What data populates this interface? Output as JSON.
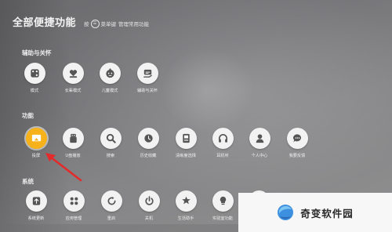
{
  "header": {
    "title": "全部便捷功能",
    "hint_prefix": "按",
    "menu_key_glyph": "☰",
    "hint_middle": "菜单键",
    "hint_suffix": "管理常用功能"
  },
  "sections": {
    "accessibility": {
      "label": "辅助与关怀",
      "items": [
        {
          "label": "模式",
          "icon": "dice-icon"
        },
        {
          "label": "长辈模式",
          "icon": "heart-hand-icon"
        },
        {
          "label": "儿童模式",
          "icon": "child-face-icon"
        },
        {
          "label": "辅助与关怀",
          "icon": "hand-care-icon"
        }
      ]
    },
    "functions": {
      "label": "功能",
      "items": [
        {
          "label": "投屏",
          "icon": "screen-cast-icon",
          "active": true
        },
        {
          "label": "U盘播放",
          "icon": "usb-drive-icon"
        },
        {
          "label": "搜索",
          "icon": "search-icon"
        },
        {
          "label": "历史收藏",
          "icon": "history-clock-icon"
        },
        {
          "label": "清晰度选择",
          "icon": "resolution-icon"
        },
        {
          "label": "耳机听",
          "icon": "headphones-icon"
        },
        {
          "label": "个人中心",
          "icon": "user-icon"
        },
        {
          "label": "我要反馈",
          "icon": "feedback-chat-icon"
        }
      ]
    },
    "system": {
      "label": "系统",
      "items": [
        {
          "label": "系统更新",
          "icon": "upload-arrow-icon"
        },
        {
          "label": "应用管理",
          "icon": "app-grid-icon"
        },
        {
          "label": "重启",
          "icon": "restart-icon"
        },
        {
          "label": "关机",
          "icon": "power-icon"
        },
        {
          "label": "生活助手",
          "icon": "sun-icon"
        },
        {
          "label": "实验室功能",
          "icon": "lab-bulb-icon"
        }
      ]
    }
  },
  "watermark": {
    "text": "奇变软件园",
    "icon": "watermark-logo-icon",
    "logo_colors": [
      "#3d8fe0",
      "#7ec6f2",
      "#2f6bb5"
    ]
  },
  "colors": {
    "active_accent": "#f7b21b",
    "arrow": "#e42b2b",
    "icon_dark": "#555555"
  }
}
